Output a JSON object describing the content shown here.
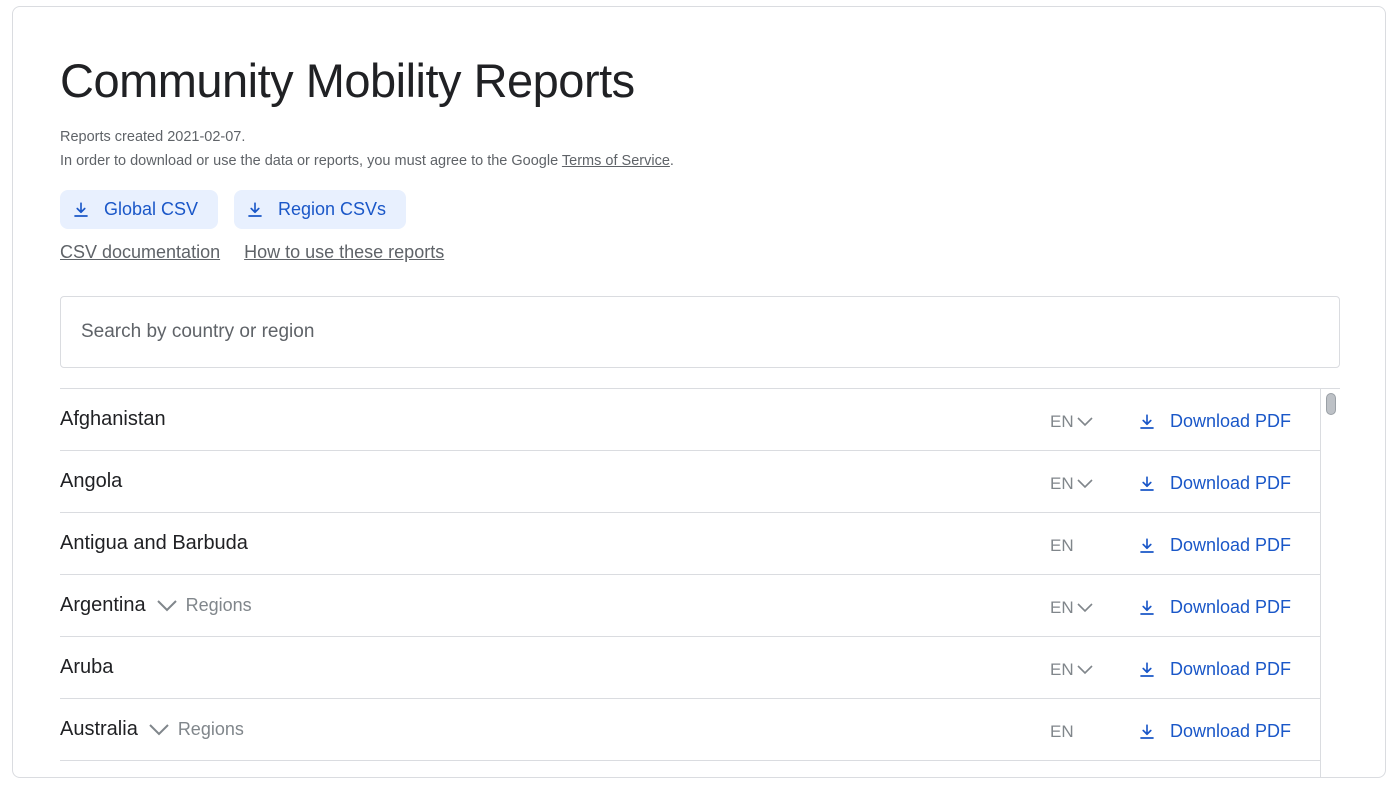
{
  "header": {
    "title": "Community Mobility Reports",
    "created": "Reports created 2021-02-07.",
    "agree_prefix": "In order to download or use the data or reports, you must agree to the Google ",
    "tos_link": "Terms of Service",
    "agree_suffix": "."
  },
  "buttons": {
    "global_csv": "Global CSV",
    "region_csvs": "Region CSVs"
  },
  "links": {
    "csv_docs": "CSV documentation",
    "how_to": "How to use these reports"
  },
  "search": {
    "placeholder": "Search by country or region",
    "value": ""
  },
  "rows": [
    {
      "country": "Afghanistan",
      "regions": "",
      "lang": "EN",
      "has_lang_menu": true,
      "download": "Download PDF"
    },
    {
      "country": "Angola",
      "regions": "",
      "lang": "EN",
      "has_lang_menu": true,
      "download": "Download PDF"
    },
    {
      "country": "Antigua and Barbuda",
      "regions": "",
      "lang": "EN",
      "has_lang_menu": false,
      "download": "Download PDF"
    },
    {
      "country": "Argentina",
      "regions": "Regions",
      "lang": "EN",
      "has_lang_menu": true,
      "download": "Download PDF"
    },
    {
      "country": "Aruba",
      "regions": "",
      "lang": "EN",
      "has_lang_menu": true,
      "download": "Download PDF"
    },
    {
      "country": "Australia",
      "regions": "Regions",
      "lang": "EN",
      "has_lang_menu": false,
      "download": "Download PDF"
    }
  ],
  "colors": {
    "accent": "#1a57c8",
    "button_bg": "#e8f0fe",
    "muted_text": "#5f6368",
    "border": "#dadce0"
  },
  "icons": {
    "download": "download-icon",
    "expand": "chevron-down-icon"
  }
}
